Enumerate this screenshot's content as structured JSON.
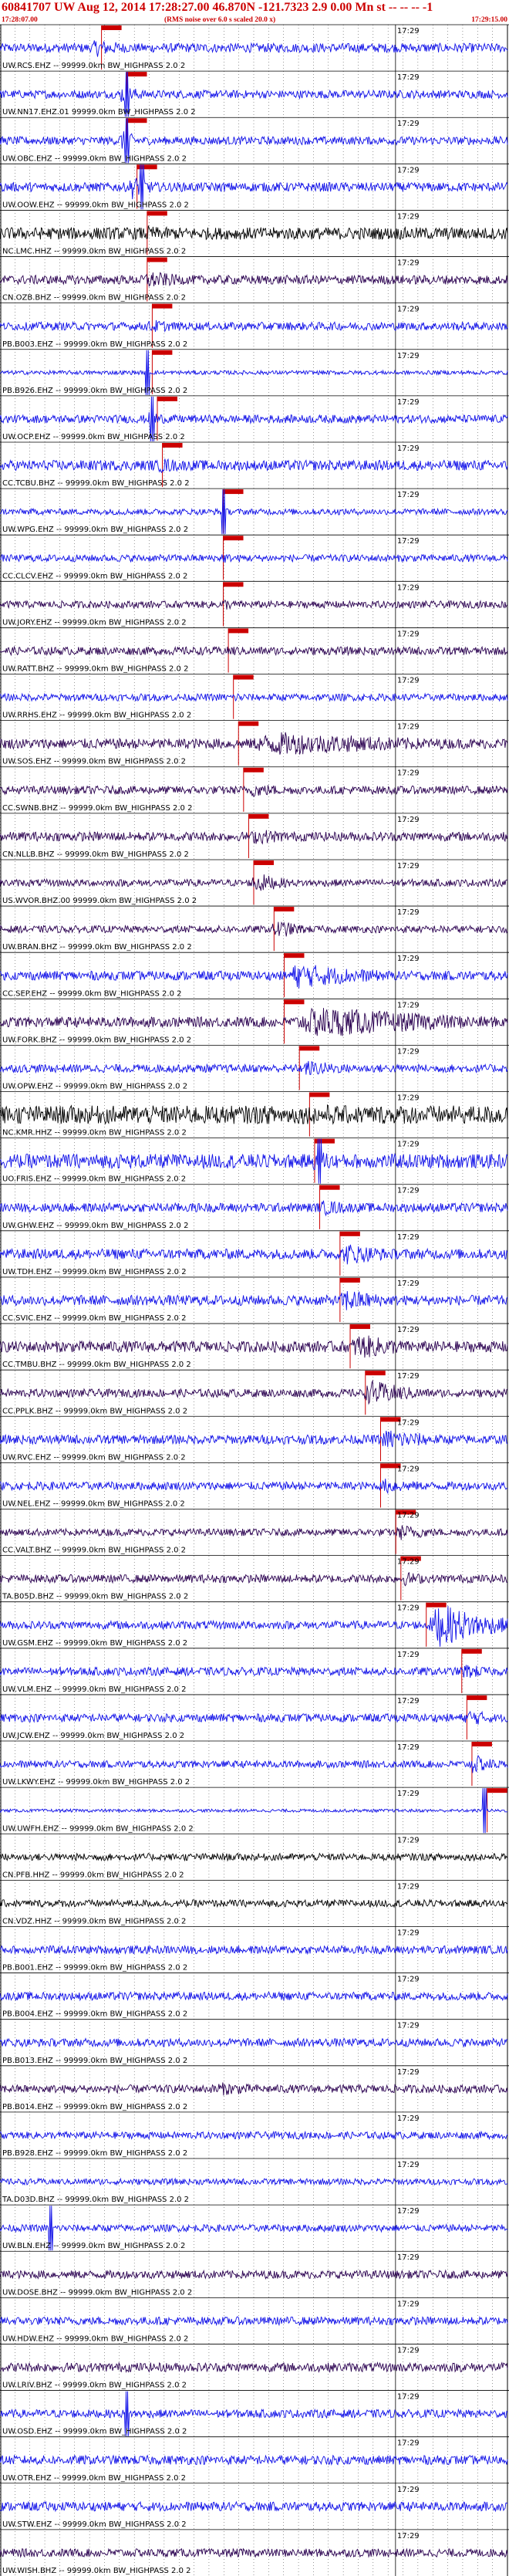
{
  "header": {
    "title": "60841707 UW Aug 12, 2014 17:28:27.00   46.870N -121.7323  2.9 0.00 Mn st -- -- --   -1",
    "start_time": "17:28:07.00",
    "note": "(RMS noise over 6.0 s scaled 20.0 x)",
    "end_time": "17:29:15.00",
    "title_color": "#cc0000"
  },
  "colors": {
    "blue": "#1010e8",
    "black": "#000000",
    "purple": "#2a0050",
    "pick": "#cc0000",
    "grid": "#000000"
  },
  "chart_data": {
    "type": "seismogram",
    "time_start": "17:28:07.00",
    "time_end": "17:29:15.00",
    "minute_mark": "17:29",
    "traces": [
      {
        "label": "UW.RCS.EHZ -- 99999.0km BW_HIGHPASS 2.0 2",
        "color": "blue",
        "amp": 0.45,
        "pick": 0.2,
        "burst_start": 0.17,
        "burst_end": 0.3,
        "burst_amp": 0.9
      },
      {
        "label": "UW.NN17.EHZ.01 99999.0km BW_HIGHPASS 2.0 2",
        "color": "blue",
        "amp": 0.4,
        "pick": 0.25,
        "burst_start": 0.23,
        "burst_end": 0.3,
        "burst_amp": 1.0,
        "spike": 0.25
      },
      {
        "label": "UW.OBC.EHZ -- 99999.0km BW_HIGHPASS 2.0 2",
        "color": "blue",
        "amp": 0.4,
        "pick": 0.25,
        "burst_start": 0.23,
        "burst_end": 0.3,
        "burst_amp": 1.0,
        "spike": 0.25
      },
      {
        "label": "UW.OOW.EHZ -- 99999.0km BW_HIGHPASS 2.0 2",
        "color": "blue",
        "amp": 0.45,
        "pick": 0.27,
        "burst_start": 0.25,
        "burst_end": 0.32,
        "burst_amp": 1.2,
        "spike": 0.28
      },
      {
        "label": "NC.LMC.HHZ -- 99999.0km BW_HIGHPASS 2.0 2",
        "color": "black",
        "amp": 0.6,
        "pick": 0.29,
        "burst_start": 0.27,
        "burst_end": 0.4,
        "burst_amp": 0.8
      },
      {
        "label": "CN.OZB.BHZ -- 99999.0km BW_HIGHPASS 2.0 2",
        "color": "purple",
        "amp": 0.45,
        "pick": 0.29,
        "burst_start": 0.27,
        "burst_end": 0.42,
        "burst_amp": 0.9
      },
      {
        "label": "PB.B003.EHZ -- 99999.0km BW_HIGHPASS 2.0 2",
        "color": "blue",
        "amp": 0.4,
        "pick": 0.3,
        "burst_start": 0.28,
        "burst_end": 0.4,
        "burst_amp": 0.7
      },
      {
        "label": "PB.B926.EHZ -- 99999.0km BW_HIGHPASS 2.0 2",
        "color": "blue",
        "amp": 0.2,
        "pick": 0.3,
        "burst_start": 0.29,
        "burst_end": 0.3,
        "burst_amp": 0.3,
        "spike": 0.29
      },
      {
        "label": "UW.OCP.EHZ -- 99999.0km BW_HIGHPASS 2.0 2",
        "color": "blue",
        "amp": 0.4,
        "pick": 0.31,
        "burst_start": 0.29,
        "burst_end": 0.33,
        "burst_amp": 1.1,
        "spike": 0.3
      },
      {
        "label": "CC.TCBU.BHZ -- 99999.0km BW_HIGHPASS 2.0 2",
        "color": "blue",
        "amp": 0.5,
        "pick": 0.32,
        "burst_start": 0.3,
        "burst_end": 0.42,
        "burst_amp": 0.8
      },
      {
        "label": "UW.WPG.EHZ -- 99999.0km BW_HIGHPASS 2.0 2",
        "color": "blue",
        "amp": 0.3,
        "pick": 0.44,
        "burst_start": 0.43,
        "burst_end": 0.45,
        "burst_amp": 0.3,
        "spike": 0.44
      },
      {
        "label": "CC.CLCV.EHZ -- 99999.0km BW_HIGHPASS 2.0 2",
        "color": "blue",
        "amp": 0.35,
        "pick": 0.44,
        "burst_start": 0.43,
        "burst_end": 0.48,
        "burst_amp": 0.6
      },
      {
        "label": "UW.JORY.EHZ -- 99999.0km BW_HIGHPASS 2.0 2",
        "color": "purple",
        "amp": 0.35,
        "pick": 0.44,
        "burst_start": 0.43,
        "burst_end": 0.5,
        "burst_amp": 0.6
      },
      {
        "label": "UW.RATT.BHZ -- 99999.0km BW_HIGHPASS 2.0 2",
        "color": "purple",
        "amp": 0.4,
        "pick": 0.45,
        "burst_start": 0.44,
        "burst_end": 0.52,
        "burst_amp": 0.6
      },
      {
        "label": "UW.RRHS.EHZ -- 99999.0km BW_HIGHPASS 2.0 2",
        "color": "blue",
        "amp": 0.35,
        "pick": 0.46,
        "burst_start": 0.45,
        "burst_end": 0.55,
        "burst_amp": 0.5
      },
      {
        "label": "UW.SOS.EHZ -- 99999.0km BW_HIGHPASS 2.0 2",
        "color": "purple",
        "amp": 0.5,
        "pick": 0.47,
        "burst_start": 0.46,
        "burst_end": 1.0,
        "burst_amp": 1.2
      },
      {
        "label": "CC.SWNB.BHZ -- 99999.0km BW_HIGHPASS 2.0 2",
        "color": "purple",
        "amp": 0.4,
        "pick": 0.48,
        "burst_start": 0.47,
        "burst_end": 0.65,
        "burst_amp": 0.7
      },
      {
        "label": "CN.NLLB.BHZ -- 99999.0km BW_HIGHPASS 2.0 2",
        "color": "purple",
        "amp": 0.45,
        "pick": 0.49,
        "burst_start": 0.48,
        "burst_end": 0.65,
        "burst_amp": 0.8
      },
      {
        "label": "US.WVOR.BHZ.00 99999.0km BW_HIGHPASS 2.0 2",
        "color": "purple",
        "amp": 0.35,
        "pick": 0.5,
        "burst_start": 0.49,
        "burst_end": 0.58,
        "burst_amp": 1.1
      },
      {
        "label": "UW.BRAN.BHZ -- 99999.0km BW_HIGHPASS 2.0 2",
        "color": "purple",
        "amp": 0.35,
        "pick": 0.54,
        "burst_start": 0.53,
        "burst_end": 0.62,
        "burst_amp": 1.0
      },
      {
        "label": "CC.SEP.EHZ -- 99999.0km BW_HIGHPASS 2.0 2",
        "color": "blue",
        "amp": 0.45,
        "pick": 0.56,
        "burst_start": 0.55,
        "burst_end": 0.8,
        "burst_amp": 1.3
      },
      {
        "label": "UW.FORK.BHZ -- 99999.0km BW_HIGHPASS 2.0 2",
        "color": "purple",
        "amp": 0.5,
        "pick": 0.56,
        "burst_start": 0.56,
        "burst_end": 1.0,
        "burst_amp": 1.6
      },
      {
        "label": "UW.OPW.EHZ -- 99999.0km BW_HIGHPASS 2.0 2",
        "color": "blue",
        "amp": 0.4,
        "pick": 0.59,
        "burst_start": 0.58,
        "burst_end": 0.75,
        "burst_amp": 0.8
      },
      {
        "label": "NC.KMR.HHZ -- 99999.0km BW_HIGHPASS 2.0 2",
        "color": "black",
        "amp": 0.9,
        "pick": 0.61,
        "burst_start": 0.6,
        "burst_end": 0.9,
        "burst_amp": 1.0
      },
      {
        "label": "UO.FRIS.EHZ -- 99999.0km BW_HIGHPASS 2.0 2",
        "color": "blue",
        "amp": 0.7,
        "pick": 0.62,
        "burst_start": 0.61,
        "burst_end": 0.7,
        "burst_amp": 1.3,
        "spike": 0.63
      },
      {
        "label": "UW.GHW.EHZ -- 99999.0km BW_HIGHPASS 2.0 2",
        "color": "blue",
        "amp": 0.45,
        "pick": 0.63,
        "burst_start": 0.62,
        "burst_end": 0.75,
        "burst_amp": 0.8
      },
      {
        "label": "UW.TDH.EHZ -- 99999.0km BW_HIGHPASS 2.0 2",
        "color": "blue",
        "amp": 0.5,
        "pick": 0.67,
        "burst_start": 0.66,
        "burst_end": 0.82,
        "burst_amp": 1.1
      },
      {
        "label": "CC.SVIC.EHZ -- 99999.0km BW_HIGHPASS 2.0 2",
        "color": "blue",
        "amp": 0.5,
        "pick": 0.67,
        "burst_start": 0.66,
        "burst_end": 0.8,
        "burst_amp": 1.2
      },
      {
        "label": "CC.TMBU.BHZ -- 99999.0km BW_HIGHPASS 2.0 2",
        "color": "purple",
        "amp": 0.55,
        "pick": 0.69,
        "burst_start": 0.68,
        "burst_end": 0.85,
        "burst_amp": 1.3
      },
      {
        "label": "CC.PPLK.BHZ -- 99999.0km BW_HIGHPASS 2.0 2",
        "color": "purple",
        "amp": 0.4,
        "pick": 0.72,
        "burst_start": 0.71,
        "burst_end": 0.85,
        "burst_amp": 1.3
      },
      {
        "label": "UW.RVC.EHZ -- 99999.0km BW_HIGHPASS 2.0 2",
        "color": "blue",
        "amp": 0.45,
        "pick": 0.75,
        "burst_start": 0.74,
        "burst_end": 0.9,
        "burst_amp": 1.1
      },
      {
        "label": "UW.NEL.EHZ -- 99999.0km BW_HIGHPASS 2.0 2",
        "color": "blue",
        "amp": 0.4,
        "pick": 0.75,
        "burst_start": 0.74,
        "burst_end": 0.88,
        "burst_amp": 0.8
      },
      {
        "label": "CC.VALT.BHZ -- 99999.0km BW_HIGHPASS 2.0 2",
        "color": "purple",
        "amp": 0.35,
        "pick": 0.78,
        "burst_start": 0.77,
        "burst_end": 0.9,
        "burst_amp": 0.8
      },
      {
        "label": "TA.B05D.BHZ -- 99999.0km BW_HIGHPASS 2.0 2",
        "color": "purple",
        "amp": 0.4,
        "pick": 0.79,
        "burst_start": 0.78,
        "burst_end": 0.9,
        "burst_amp": 0.7
      },
      {
        "label": "UW.GSM.EHZ -- 99999.0km BW_HIGHPASS 2.0 2",
        "color": "blue",
        "amp": 0.4,
        "pick": 0.84,
        "burst_start": 0.84,
        "burst_end": 1.0,
        "burst_amp": 2.2
      },
      {
        "label": "UW.VLM.EHZ -- 99999.0km BW_HIGHPASS 2.0 2",
        "color": "blue",
        "amp": 0.4,
        "pick": 0.91,
        "burst_start": 0.9,
        "burst_end": 1.0,
        "burst_amp": 0.8
      },
      {
        "label": "UW.JCW.EHZ -- 99999.0km BW_HIGHPASS 2.0 2",
        "color": "blue",
        "amp": 0.4,
        "pick": 0.92,
        "burst_start": 0.91,
        "burst_end": 1.0,
        "burst_amp": 0.9
      },
      {
        "label": "UW.LKWY.EHZ -- 99999.0km BW_HIGHPASS 2.0 2",
        "color": "blue",
        "amp": 0.35,
        "pick": 0.93,
        "burst_start": 0.92,
        "burst_end": 1.0,
        "burst_amp": 1.0
      },
      {
        "label": "UW.UWFH.EHZ -- 99999.0km BW_HIGHPASS 2.0 2",
        "color": "blue",
        "amp": 0.15,
        "pick": 0.96,
        "burst_start": 0.95,
        "burst_end": 0.96,
        "burst_amp": 0.2,
        "spike": 0.955
      },
      {
        "label": "CN.PFB.HHZ -- 99999.0km BW_HIGHPASS 2.0 2",
        "color": "black",
        "amp": 0.35
      },
      {
        "label": "CN.VDZ.HHZ -- 99999.0km BW_HIGHPASS 2.0 2",
        "color": "black",
        "amp": 0.35
      },
      {
        "label": "PB.B001.EHZ -- 99999.0km BW_HIGHPASS 2.0 2",
        "color": "blue",
        "amp": 0.4
      },
      {
        "label": "PB.B004.EHZ -- 99999.0km BW_HIGHPASS 2.0 2",
        "color": "blue",
        "amp": 0.4
      },
      {
        "label": "PB.B013.EHZ -- 99999.0km BW_HIGHPASS 2.0 2",
        "color": "blue",
        "amp": 0.4
      },
      {
        "label": "PB.B014.EHZ -- 99999.0km BW_HIGHPASS 2.0 2",
        "color": "purple",
        "amp": 0.4,
        "burst_start": 0.4,
        "burst_end": 0.6,
        "burst_amp": 0.7
      },
      {
        "label": "PB.B928.EHZ -- 99999.0km BW_HIGHPASS 2.0 2",
        "color": "blue",
        "amp": 0.35
      },
      {
        "label": "TA.D03D.BHZ -- 99999.0km BW_HIGHPASS 2.0 2",
        "color": "blue",
        "amp": 0.3
      },
      {
        "label": "UW.BLN.EHZ -- 99999.0km BW_HIGHPASS 2.0 2",
        "color": "blue",
        "amp": 0.35,
        "spike": 0.1
      },
      {
        "label": "UW.DOSE.BHZ -- 99999.0km BW_HIGHPASS 2.0 2",
        "color": "purple",
        "amp": 0.4
      },
      {
        "label": "UW.HDW.EHZ -- 99999.0km BW_HIGHPASS 2.0 2",
        "color": "blue",
        "amp": 0.4
      },
      {
        "label": "UW.LRIV.BHZ -- 99999.0km BW_HIGHPASS 2.0 2",
        "color": "purple",
        "amp": 0.45
      },
      {
        "label": "UW.OSD.EHZ -- 99999.0km BW_HIGHPASS 2.0 2",
        "color": "blue",
        "amp": 0.4,
        "spike": 0.25
      },
      {
        "label": "UW.OTR.EHZ -- 99999.0km BW_HIGHPASS 2.0 2",
        "color": "blue",
        "amp": 0.45
      },
      {
        "label": "UW.STW.EHZ -- 99999.0km BW_HIGHPASS 2.0 2",
        "color": "blue",
        "amp": 0.45
      },
      {
        "label": "UW.WISH.BHZ -- 99999.0km BW_HIGHPASS 2.0 2",
        "color": "purple",
        "amp": 0.4
      }
    ]
  }
}
